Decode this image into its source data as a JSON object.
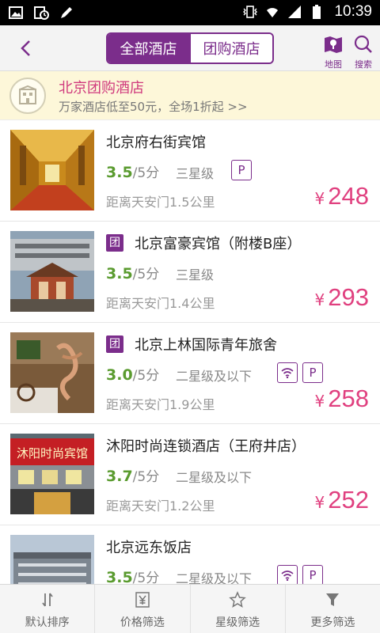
{
  "statusbar": {
    "time": "10:39"
  },
  "header": {
    "tab_all": "全部酒店",
    "tab_group": "团购酒店",
    "map_label": "地图",
    "search_label": "搜索"
  },
  "banner": {
    "title": "北京团购酒店",
    "subtitle": "万家酒店低至50元，全场1折起  >>"
  },
  "hotels": [
    {
      "name": "北京府右街宾馆",
      "group": false,
      "score": "3.5",
      "score_suffix": "/5分",
      "star": "三星级",
      "tags": [
        "P"
      ],
      "distance": "距离天安门1.5公里",
      "currency": "¥",
      "price": "248"
    },
    {
      "name": "北京富豪宾馆（附楼B座）",
      "group": true,
      "group_label": "团",
      "score": "3.5",
      "score_suffix": "/5分",
      "star": "三星级",
      "tags": [],
      "distance": "距离天安门1.4公里",
      "currency": "¥",
      "price": "293"
    },
    {
      "name": "北京上林国际青年旅舍",
      "group": true,
      "group_label": "团",
      "score": "3.0",
      "score_suffix": "/5分",
      "star": "二星级及以下",
      "tags": [
        "wifi",
        "P"
      ],
      "distance": "距离天安门1.9公里",
      "currency": "¥",
      "price": "258"
    },
    {
      "name": "沐阳时尚连锁酒店（王府井店）",
      "group": false,
      "score": "3.7",
      "score_suffix": "/5分",
      "star": "二星级及以下",
      "tags": [],
      "distance": "距离天安门1.2公里",
      "currency": "¥",
      "price": "252"
    },
    {
      "name": "北京远东饭店",
      "group": false,
      "score": "3.5",
      "score_suffix": "/5分",
      "star": "二星级及以下",
      "tags": [
        "wifi",
        "P"
      ],
      "distance": "",
      "currency": "",
      "price": ""
    }
  ],
  "thumb_sign_text": "沐阳时尚宾馆",
  "tabs": {
    "sort": "默认排序",
    "price": "价格筛选",
    "star": "星级筛选",
    "more": "更多筛选"
  },
  "colors": {
    "accent": "#7b2d8b",
    "price": "#e0407f",
    "score": "#5a9b2f"
  }
}
